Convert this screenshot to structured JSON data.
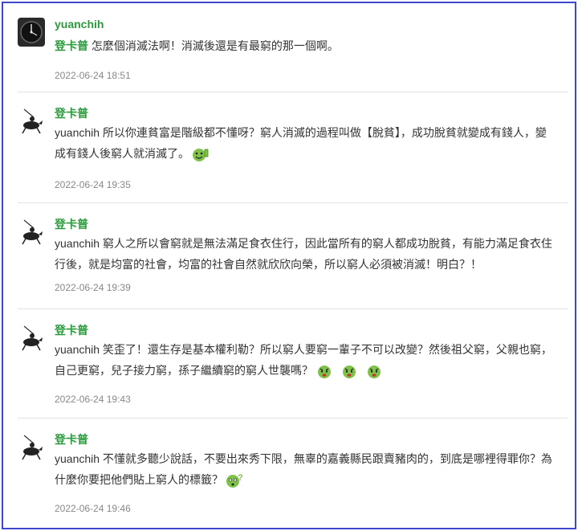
{
  "comments": [
    {
      "author": "yuanchih",
      "avatar": "watch-face-avatar",
      "mention": "登卡普",
      "text": " 怎麼個消滅法啊！消滅後還是有最窮的那一個啊。",
      "time": "2022-06-24 18:51"
    },
    {
      "author": "登卡普",
      "avatar": "polo-rider-avatar",
      "mention": "yuanchih",
      "line1": " 所以你連貧富是階級都不懂呀？窮人消滅的過程叫做【脫貧】，成功脫貧就變成有錢人，變",
      "line2": "成有錢人後窮人就消滅了。",
      "emoticons": [
        "cheering-emoticon"
      ],
      "time": "2022-06-24 19:35"
    },
    {
      "author": "登卡普",
      "avatar": "polo-rider-avatar",
      "mention": "yuanchih",
      "line1": " 窮人之所以會窮就是無法滿足食衣住行，因此當所有的窮人都成功脫貧，有能力滿足食衣住",
      "line2": "行後，就是均富的社會，均富的社會自然就欣欣向榮，所以窮人必須被消滅！明白？！",
      "time": "2022-06-24 19:39"
    },
    {
      "author": "登卡普",
      "avatar": "polo-rider-avatar",
      "mention": "yuanchih",
      "line1": " 笑歪了！還生存是基本權利勒？所以窮人要窮一輩子不可以改變？然後祖父窮，父親也窮，",
      "line2": "自己更窮，兒子接力窮，孫子繼續窮的窮人世襲嗎？",
      "emoticons": [
        "angry-emoticon",
        "angry-emoticon",
        "angry-emoticon"
      ],
      "time": "2022-06-24 19:43"
    },
    {
      "author": "登卡普",
      "avatar": "polo-rider-avatar",
      "mention": "yuanchih",
      "line1": " 不懂就多聽少說話，不要出來秀下限，無辜的嘉義縣民跟賣豬肉的，到底是哪裡得罪你？為",
      "line2": "什麼你要把他們貼上窮人的標籤？",
      "emoticons": [
        "question-emoticon"
      ],
      "time": "2022-06-24 19:46"
    }
  ],
  "colors": {
    "border": "#3f48cc",
    "author": "#2b9a3c",
    "emoticon": "#7fc24a"
  }
}
